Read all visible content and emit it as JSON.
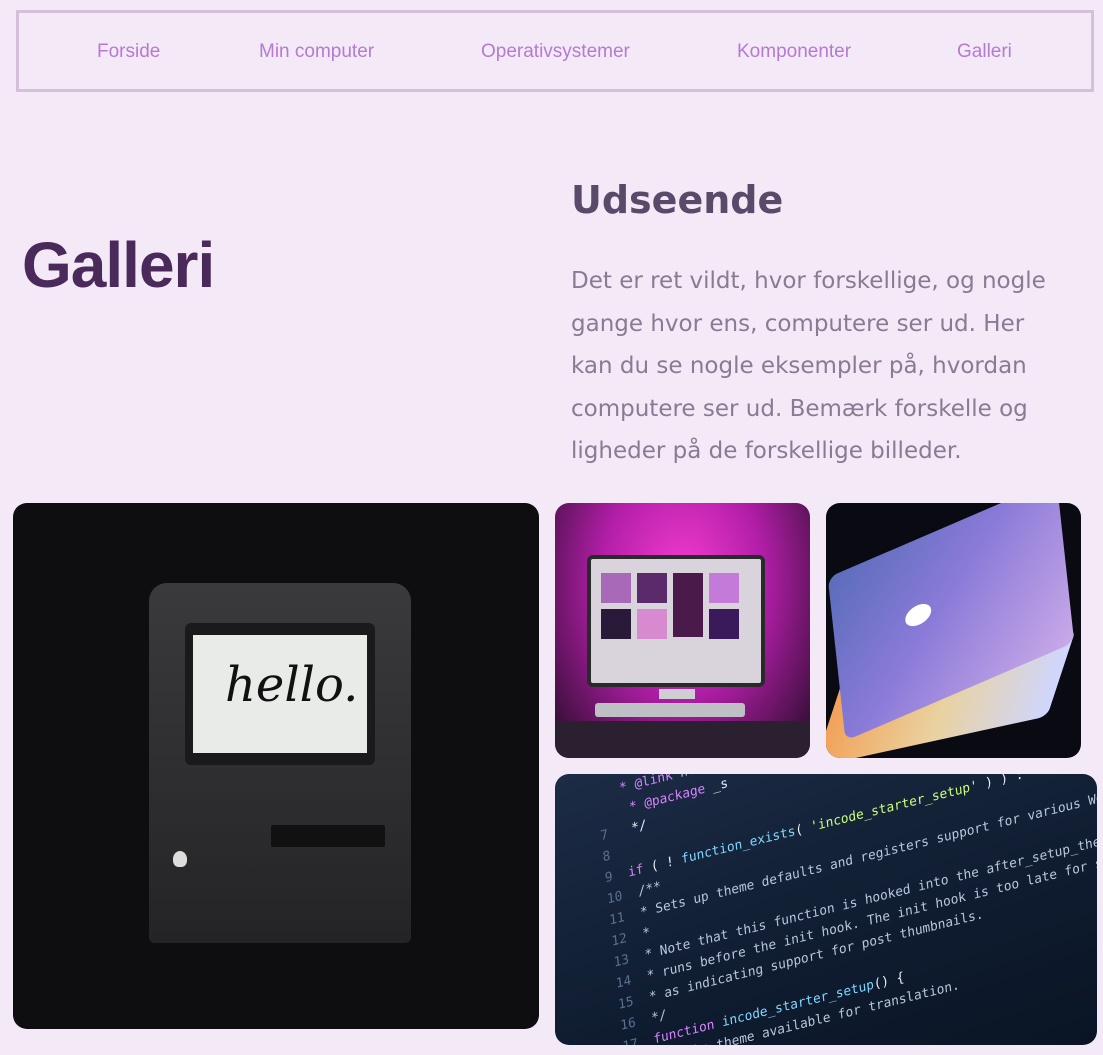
{
  "nav": {
    "items": [
      "Forside",
      "Min computer",
      "Operativsystemer",
      "Komponenter",
      "Galleri"
    ]
  },
  "page": {
    "title": "Galleri"
  },
  "section": {
    "title": "Udseende",
    "text": "Det er ret vildt, hvor forskellige, og nogle gange hvor ens, computere ser ud. Her kan du se nogle eksempler på, hvordan computere ser ud. Bemærk forskelle og ligheder på de forskellige billeder."
  },
  "gallery": {
    "mac_screen_text": "hello.",
    "code_lines": [
      {
        "n": "",
        "parts": [
          [
            "c-kw",
            "* @link "
          ],
          [
            "c-cm",
            "https://developer.wordpress.org"
          ]
        ]
      },
      {
        "n": "",
        "parts": [
          [
            "c-kw",
            " * @package "
          ],
          [
            "c-tx",
            "_s"
          ]
        ]
      },
      {
        "n": "7",
        "parts": [
          [
            "c-tx",
            " */"
          ]
        ]
      },
      {
        "n": "8",
        "parts": []
      },
      {
        "n": "9",
        "parts": [
          [
            "c-kw",
            "if "
          ],
          [
            "c-tx",
            "( ! "
          ],
          [
            "c-fn",
            "function_exists"
          ],
          [
            "c-tx",
            "( "
          ],
          [
            "c-st",
            "'incode_starter_setup'"
          ],
          [
            "c-tx",
            " ) ) :"
          ]
        ]
      },
      {
        "n": "10",
        "parts": [
          [
            "c-cm",
            "  /**"
          ]
        ]
      },
      {
        "n": "11",
        "parts": [
          [
            "c-cm",
            "   * Sets up theme defaults and registers support for various WordPress features."
          ]
        ]
      },
      {
        "n": "12",
        "parts": [
          [
            "c-cm",
            "   *"
          ]
        ]
      },
      {
        "n": "13",
        "parts": [
          [
            "c-cm",
            "   * Note that this function is hooked into the after_setup_theme hook, which"
          ]
        ]
      },
      {
        "n": "14",
        "parts": [
          [
            "c-cm",
            "   * runs before the init hook. The init hook is too late for some features, such"
          ]
        ]
      },
      {
        "n": "15",
        "parts": [
          [
            "c-cm",
            "   * as indicating support for post thumbnails."
          ]
        ]
      },
      {
        "n": "16",
        "parts": [
          [
            "c-cm",
            "   */"
          ]
        ]
      },
      {
        "n": "17",
        "parts": [
          [
            "c-kw",
            "  function "
          ],
          [
            "c-fn",
            "incode_starter_setup"
          ],
          [
            "c-tx",
            "() {"
          ]
        ]
      },
      {
        "n": "18",
        "parts": [
          [
            "c-cm",
            "    /* Make theme available for translation."
          ]
        ]
      }
    ]
  }
}
